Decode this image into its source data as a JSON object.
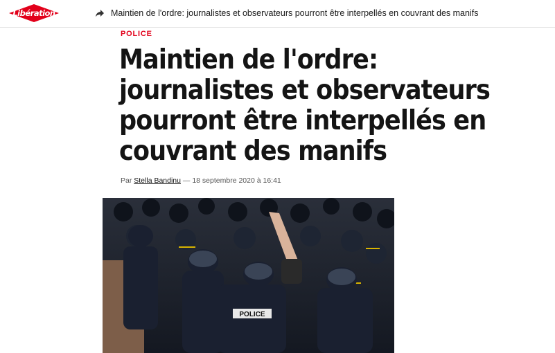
{
  "header": {
    "logo_text": "Libération",
    "share_icon": "share-arrow-icon",
    "article_title": "Maintien de l'ordre: journalistes et observateurs pourront être interpellés en couvrant des manifs"
  },
  "article": {
    "rubric": "POLICE",
    "headline": "Maintien de l'ordre: journalistes et observateurs pourront être interpellés en couvrant des manifs",
    "byline_prefix": "Par",
    "author": "Stella Bandinu",
    "byline_sep": "—",
    "date": "18 septembre 2020 à 16:41",
    "photo_badge": "POLICE"
  },
  "colors": {
    "brand_red": "#e2001a",
    "text": "#141414"
  }
}
